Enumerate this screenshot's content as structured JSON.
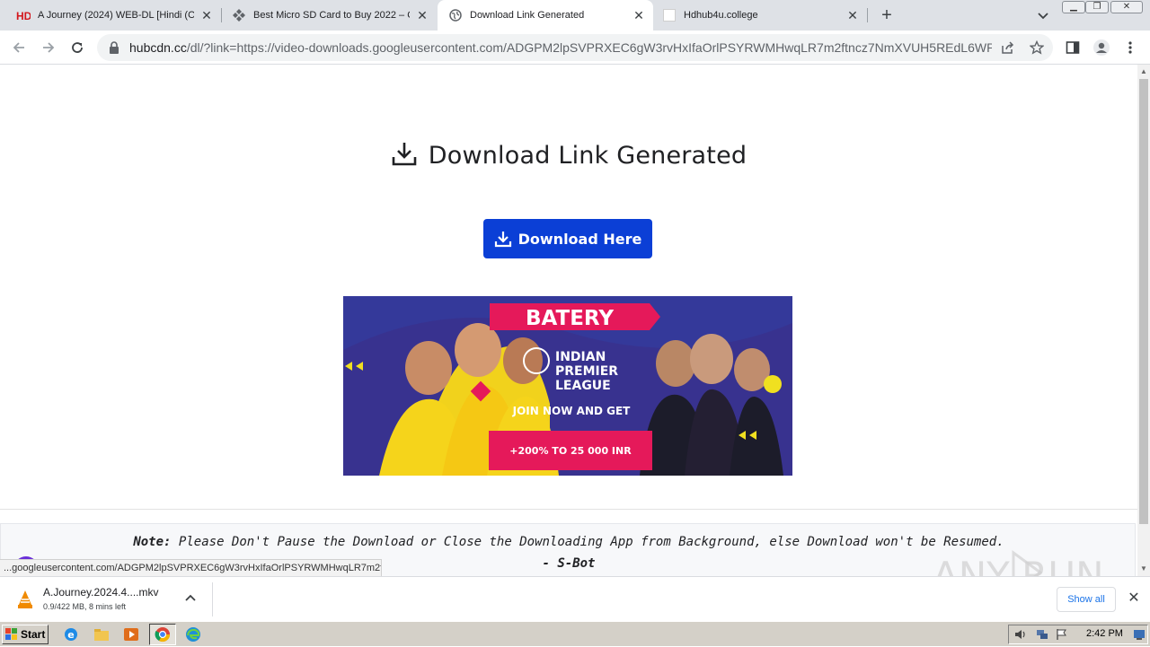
{
  "browser": {
    "tabs": [
      {
        "title": "A Journey (2024) WEB-DL [Hindi (OF",
        "favicon": "hd-logo-icon",
        "active": false
      },
      {
        "title": "Best Micro SD Card to Buy 2022 – O",
        "favicon": "diamond-arrows-icon",
        "active": false
      },
      {
        "title": "Download Link Generated",
        "favicon": "globe-icon",
        "active": true
      },
      {
        "title": "Hdhub4u.college",
        "favicon": "blank-page-icon",
        "active": false
      }
    ],
    "url_host": "hubcdn.cc",
    "url_rest": "/dl/?link=https://video-downloads.googleusercontent.com/ADGPM2lpSVPRXEC6gW3rvHxIfaOrlPSYRWMHwqLR7m2ftncz7NmXVUH5REdL6WPB..."
  },
  "page": {
    "heading": "Download Link Generated",
    "download_button": "Download Here",
    "banner": {
      "brand": "BATERY",
      "league_line1": "INDIAN",
      "league_line2": "PREMIER",
      "league_line3": "LEAGUE",
      "cta": "JOIN NOW AND GET",
      "bonus": "+200% TO 25 000 INR"
    },
    "note_label": "Note:",
    "note_text": "Please Don't Pause the Download or Close the Downloading App from Background, else Download won't be Resumed.",
    "signature": "- S-Bot"
  },
  "status_bar_url": "...googleusercontent.com/ADGPM2lpSVPRXEC6gW3rvHxIfaOrlPSYRWMHwqLR7m2ft...",
  "download_shelf": {
    "filename": "A.Journey.2024.4....mkv",
    "progress": "0.9/422 MB, 8 mins left",
    "show_all": "Show all"
  },
  "watermark": "ANY RUN",
  "taskbar": {
    "start_label": "Start",
    "clock": "2:42 PM"
  },
  "colors": {
    "accent_button": "#0b3fd6",
    "banner_pink": "#e5195a"
  }
}
